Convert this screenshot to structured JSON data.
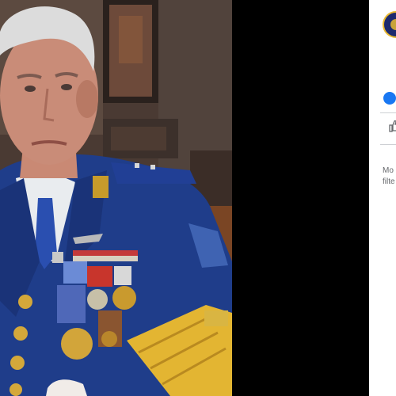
{
  "viewer": {
    "comment_text_line1": "Mo",
    "comment_text_line2": "filte"
  },
  "icons": {
    "page_avatar": "page-avatar-icon",
    "reaction": "like-reaction-icon",
    "like_button": "thumbs-up-icon"
  },
  "colors": {
    "uniform_blue": "#1f3d8a",
    "gold_braid": "#e3b532",
    "facebook_blue": "#1877f2",
    "panel_text": "#65676b"
  }
}
